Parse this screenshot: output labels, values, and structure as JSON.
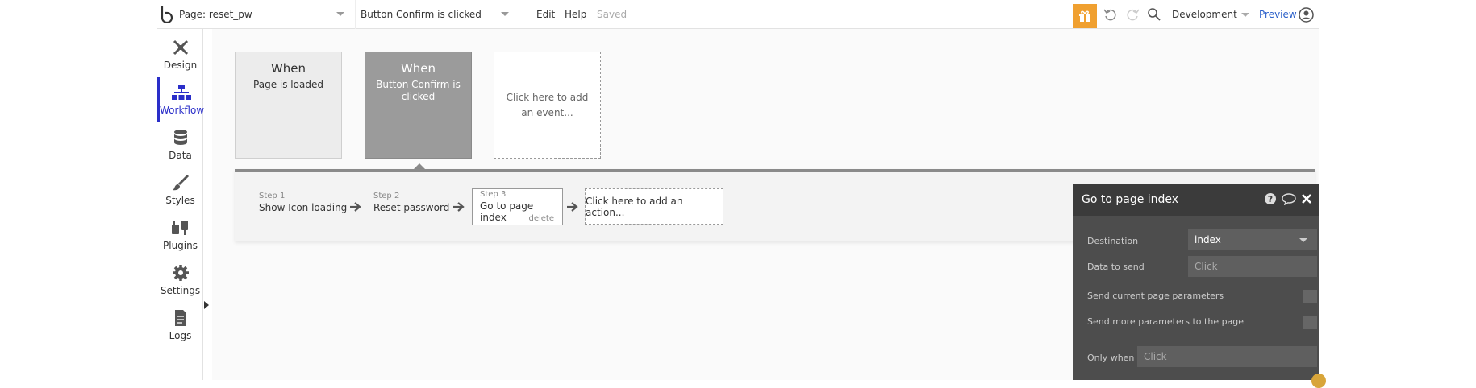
{
  "topbar": {
    "page_label": "Page: reset_pw",
    "event_label": "Button Confirm is clicked",
    "edit": "Edit",
    "help": "Help",
    "saved": "Saved",
    "environment": "Development",
    "preview": "Preview"
  },
  "nav": {
    "items": [
      {
        "label": "Design",
        "icon": "design-icon"
      },
      {
        "label": "Workflow",
        "icon": "workflow-icon",
        "active": true
      },
      {
        "label": "Data",
        "icon": "database-icon"
      },
      {
        "label": "Styles",
        "icon": "brush-icon"
      },
      {
        "label": "Plugins",
        "icon": "plug-icon"
      },
      {
        "label": "Settings",
        "icon": "gear-icon"
      },
      {
        "label": "Logs",
        "icon": "document-icon"
      }
    ]
  },
  "events": [
    {
      "when": "When",
      "desc": "Page is loaded"
    },
    {
      "when": "When",
      "desc": "Button Confirm is clicked"
    },
    {
      "add": "Click here to add an event..."
    }
  ],
  "steps": [
    {
      "num": "Step 1",
      "name": "Show Icon loading"
    },
    {
      "num": "Step 2",
      "name": "Reset password"
    },
    {
      "num": "Step 3",
      "name": "Go to page index",
      "delete": "delete"
    }
  ],
  "add_action": "Click here to add an action...",
  "panel": {
    "title": "Go to page index",
    "destination_label": "Destination",
    "destination_value": "index",
    "data_label": "Data to send",
    "data_placeholder": "Click",
    "send_current_label": "Send current page parameters",
    "send_more_label": "Send more parameters to the page",
    "only_when_label": "Only when",
    "only_when_placeholder": "Click"
  },
  "colors": {
    "accent": "#2a2ec9",
    "gift": "#f0a030",
    "panel": "#4d4d4d"
  }
}
